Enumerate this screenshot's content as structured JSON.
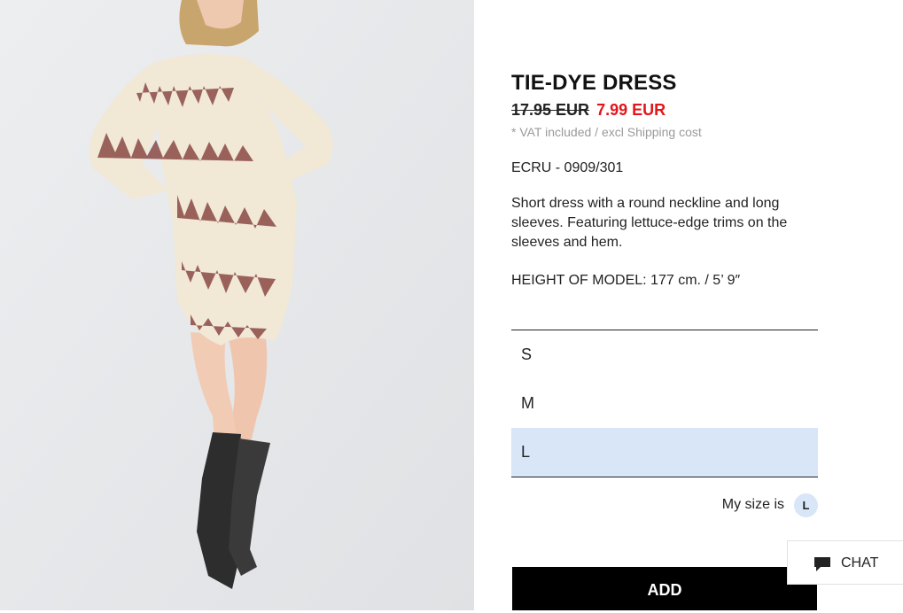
{
  "product": {
    "title": "TIE-DYE DRESS",
    "original_price": "17.95 EUR",
    "sale_price": "7.99 EUR",
    "vat_note": "* VAT included / excl Shipping cost",
    "color_ref": "ECRU - 0909/301",
    "description": "Short dress with a round neckline and long sleeves. Featuring lettuce-edge trims on the sleeves and hem.",
    "model_height": "HEIGHT OF MODEL: 177 cm. / 5’ 9″"
  },
  "sizes": {
    "options": [
      "S",
      "M",
      "L"
    ],
    "selected": "L"
  },
  "my_size": {
    "label": "My size is",
    "value": "L"
  },
  "actions": {
    "add_label": "ADD",
    "chat_label": "CHAT"
  },
  "colors": {
    "sale_red": "#e3151a",
    "selection_blue": "#d8e6f8",
    "add_button_bg": "#000000"
  },
  "icons": {
    "chat": "chat-bubble-icon"
  }
}
